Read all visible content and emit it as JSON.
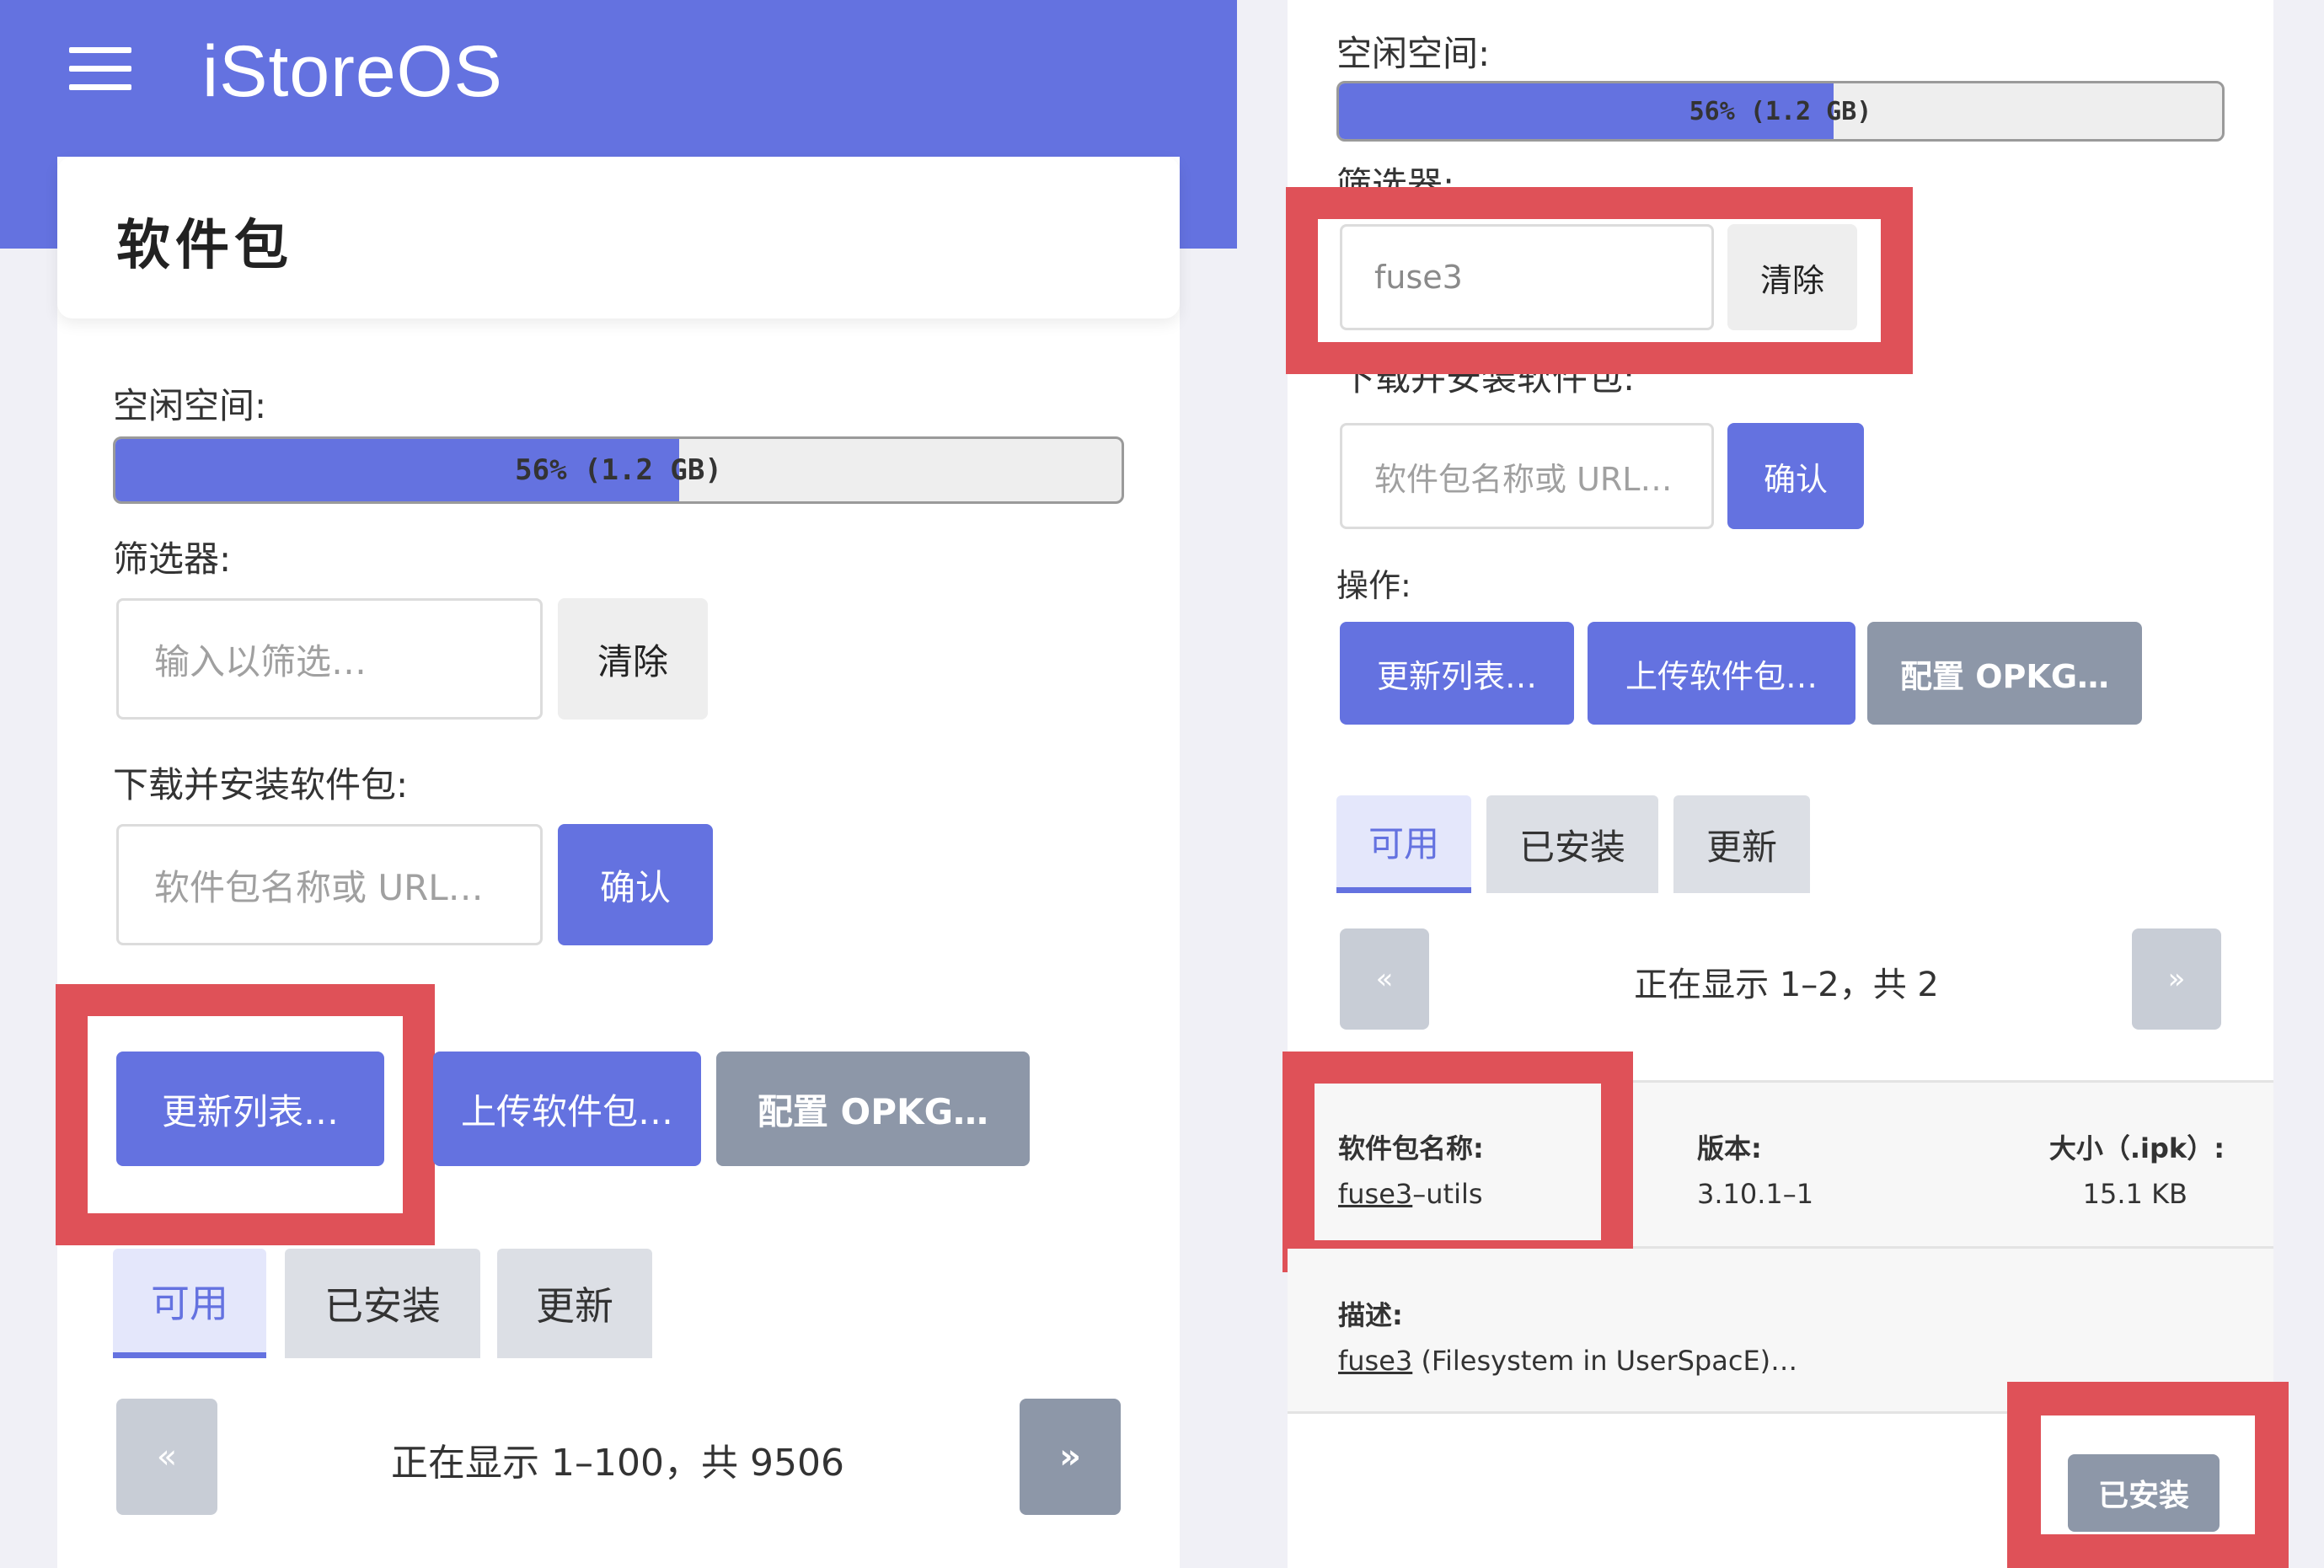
{
  "header": {
    "brand": "iStoreOS"
  },
  "left": {
    "title": "软件包",
    "free_space_label": "空闲空间:",
    "progress": {
      "percent": 56,
      "text": "56% (1.2 GB)"
    },
    "filter_label": "筛选器:",
    "filter_input": {
      "placeholder": "输入以筛选…",
      "value": ""
    },
    "clear_button": "清除",
    "install_label": "下载并安装软件包:",
    "install_input": {
      "placeholder": "软件包名称或 URL…"
    },
    "confirm_button": "确认",
    "actions": [
      "更新列表…",
      "上传软件包…",
      "配置 OPKG…"
    ],
    "tabs": [
      "可用",
      "已安装",
      "更新"
    ],
    "pager": {
      "prev": "«",
      "text": "正在显示 1–100，共 9506",
      "next": "»"
    }
  },
  "right": {
    "free_space_label": "空闲空间:",
    "progress": {
      "percent": 56,
      "text": "56% (1.2 GB)"
    },
    "filter_label": "筛选器:",
    "filter_input": {
      "value": "fuse3"
    },
    "clear_button": "清除",
    "install_label": "下载并安装软件包:",
    "install_input": {
      "placeholder": "软件包名称或 URL…"
    },
    "confirm_button": "确认",
    "actions_label": "操作:",
    "actions": [
      "更新列表…",
      "上传软件包…",
      "配置 OPKG…"
    ],
    "tabs": [
      "可用",
      "已安装",
      "更新"
    ],
    "pager": {
      "prev": "«",
      "text": "正在显示 1–2，共 2",
      "next": "»"
    },
    "package": {
      "name_label": "软件包名称:",
      "name_link": "fuse3",
      "name_suffix": "–utils",
      "version_label": "版本:",
      "version": "3.10.1–1",
      "size_label": "大小（.ipk）:",
      "size": "15.1 KB",
      "desc_label": "描述:",
      "desc_link": "fuse3",
      "desc_rest": " (Filesystem in UserSpacE)…",
      "installed_button": "已安装"
    }
  },
  "colors": {
    "accent": "#6472e0",
    "highlight": "#df5158",
    "gray_button": "#8d97a8"
  }
}
